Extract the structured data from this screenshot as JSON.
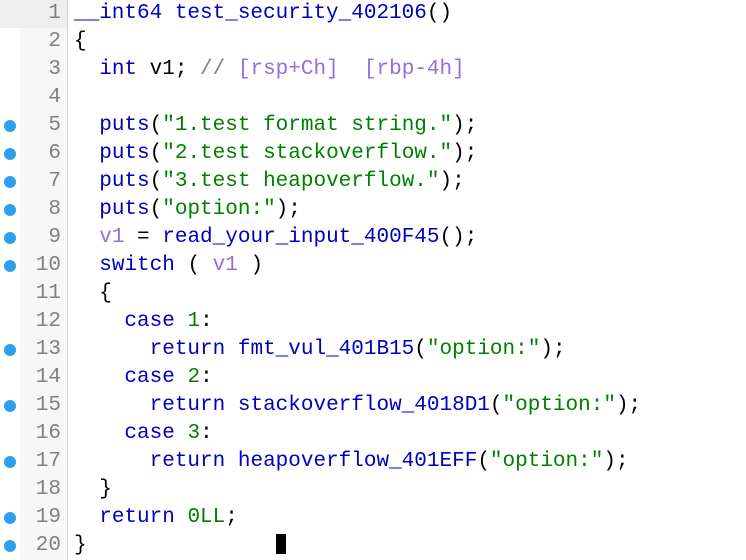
{
  "lines": [
    {
      "n": 1,
      "bp": false
    },
    {
      "n": 2,
      "bp": false
    },
    {
      "n": 3,
      "bp": false
    },
    {
      "n": 4,
      "bp": false
    },
    {
      "n": 5,
      "bp": true
    },
    {
      "n": 6,
      "bp": true
    },
    {
      "n": 7,
      "bp": true
    },
    {
      "n": 8,
      "bp": true
    },
    {
      "n": 9,
      "bp": true
    },
    {
      "n": 10,
      "bp": true
    },
    {
      "n": 11,
      "bp": false
    },
    {
      "n": 12,
      "bp": false
    },
    {
      "n": 13,
      "bp": true
    },
    {
      "n": 14,
      "bp": false
    },
    {
      "n": 15,
      "bp": true
    },
    {
      "n": 16,
      "bp": false
    },
    {
      "n": 17,
      "bp": true
    },
    {
      "n": 18,
      "bp": false
    },
    {
      "n": 19,
      "bp": true
    },
    {
      "n": 20,
      "bp": true
    }
  ],
  "t": {
    "ret_type": "__int64",
    "func_name": " test_security_402106",
    "paren": "()",
    "lbrace": "{",
    "rbrace": "}",
    "decl_indent": "  ",
    "int_kw": "int",
    "v1_decl": " v1",
    "semi": ";",
    "cmt_sl": " // ",
    "reg1": "[rsp+Ch]",
    "reg_sp": "  ",
    "reg2": "[rbp-4h]",
    "body_indent": "  ",
    "puts": "puts",
    "lp": "(",
    "rp": ")",
    "s1": "\"1.test format string.\"",
    "s2": "\"2.test stackoverflow.\"",
    "s3": "\"3.test heapoverflow.\"",
    "s_opt": "\"option:\"",
    "v1_use": "v1",
    "eq": " = ",
    "read_input": "read_your_input_400F45",
    "switch_kw": "switch",
    "sw_sp": " ( ",
    "sw_cp": " )",
    "case_indent": "    ",
    "case_kw": "case",
    "colon": ":",
    "c1": " 1",
    "c2": " 2",
    "c3": " 3",
    "ret_indent": "      ",
    "return_kw": "return",
    "sp": " ",
    "fmt_vul": "fmt_vul_401B15",
    "stackoverflow": "stackoverflow_4018D1",
    "heapoverflow": "heapoverflow_401EFF",
    "zero_ll": "0LL",
    "inner_lbrace_indent": "  ",
    "inner_rbrace_indent": "  "
  }
}
